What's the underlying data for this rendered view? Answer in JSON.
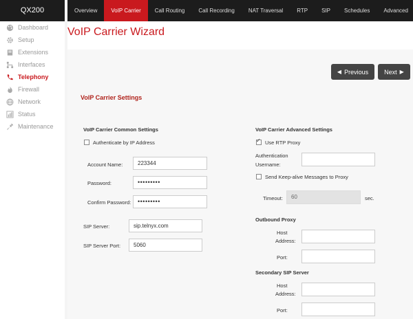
{
  "brand": "QX200",
  "top_tabs": [
    {
      "label": "Overview",
      "active": false
    },
    {
      "label": "VoIP Carrier",
      "active": true
    },
    {
      "label": "Call Routing",
      "active": false
    },
    {
      "label": "Call Recording",
      "active": false
    },
    {
      "label": "NAT Traversal",
      "active": false
    },
    {
      "label": "RTP",
      "active": false
    },
    {
      "label": "SIP",
      "active": false
    },
    {
      "label": "Schedules",
      "active": false
    },
    {
      "label": "Advanced",
      "active": false
    }
  ],
  "sidebar": {
    "items": [
      {
        "label": "Dashboard",
        "icon": "palette-icon"
      },
      {
        "label": "Setup",
        "icon": "gear-icon"
      },
      {
        "label": "Extensions",
        "icon": "book-icon"
      },
      {
        "label": "Interfaces",
        "icon": "network-tree-icon"
      },
      {
        "label": "Telephony",
        "icon": "phone-icon",
        "active": true
      },
      {
        "label": "Firewall",
        "icon": "flame-icon"
      },
      {
        "label": "Network",
        "icon": "globe-icon"
      },
      {
        "label": "Status",
        "icon": "bar-chart-icon"
      },
      {
        "label": "Maintenance",
        "icon": "wrench-icon"
      }
    ]
  },
  "page": {
    "title": "VoIP Carrier Wizard",
    "prev_label": "Previous",
    "next_label": "Next",
    "section_title": "VoIP Carrier Settings"
  },
  "common": {
    "heading": "VoIP Carrier Common Settings",
    "auth_by_ip_label": "Authenticate by IP Address",
    "auth_by_ip_checked": false,
    "account_name_label": "Account Name:",
    "account_name_value": "223344",
    "password_label": "Password:",
    "password_value": "•••••••••",
    "confirm_password_label": "Confirm Password:",
    "confirm_password_value": "•••••••••",
    "sip_server_label": "SIP Server:",
    "sip_server_value": "sip.telnyx.com",
    "sip_server_port_label": "SIP Server Port:",
    "sip_server_port_value": "5060"
  },
  "advanced": {
    "heading": "VoIP Carrier Advanced Settings",
    "use_rtp_proxy_label": "Use RTP Proxy",
    "use_rtp_proxy_checked": true,
    "auth_username_label_1": "Authentication",
    "auth_username_label_2": "Username:",
    "auth_username_value": "",
    "keepalive_label": "Send Keep-alive Messages to Proxy",
    "keepalive_checked": false,
    "timeout_label": "Timeout:",
    "timeout_value": "60",
    "timeout_unit": "sec.",
    "outbound_proxy_heading": "Outbound Proxy",
    "host_label_1": "Host",
    "host_label_2": "Address:",
    "port_label": "Port:",
    "outbound_host_value": "",
    "outbound_port_value": "",
    "secondary_sip_heading": "Secondary SIP Server",
    "secondary_host_value": "",
    "secondary_port_value": ""
  },
  "colors": {
    "accent": "#c9191e",
    "topbar": "#1c1c1c",
    "button": "#444444"
  }
}
